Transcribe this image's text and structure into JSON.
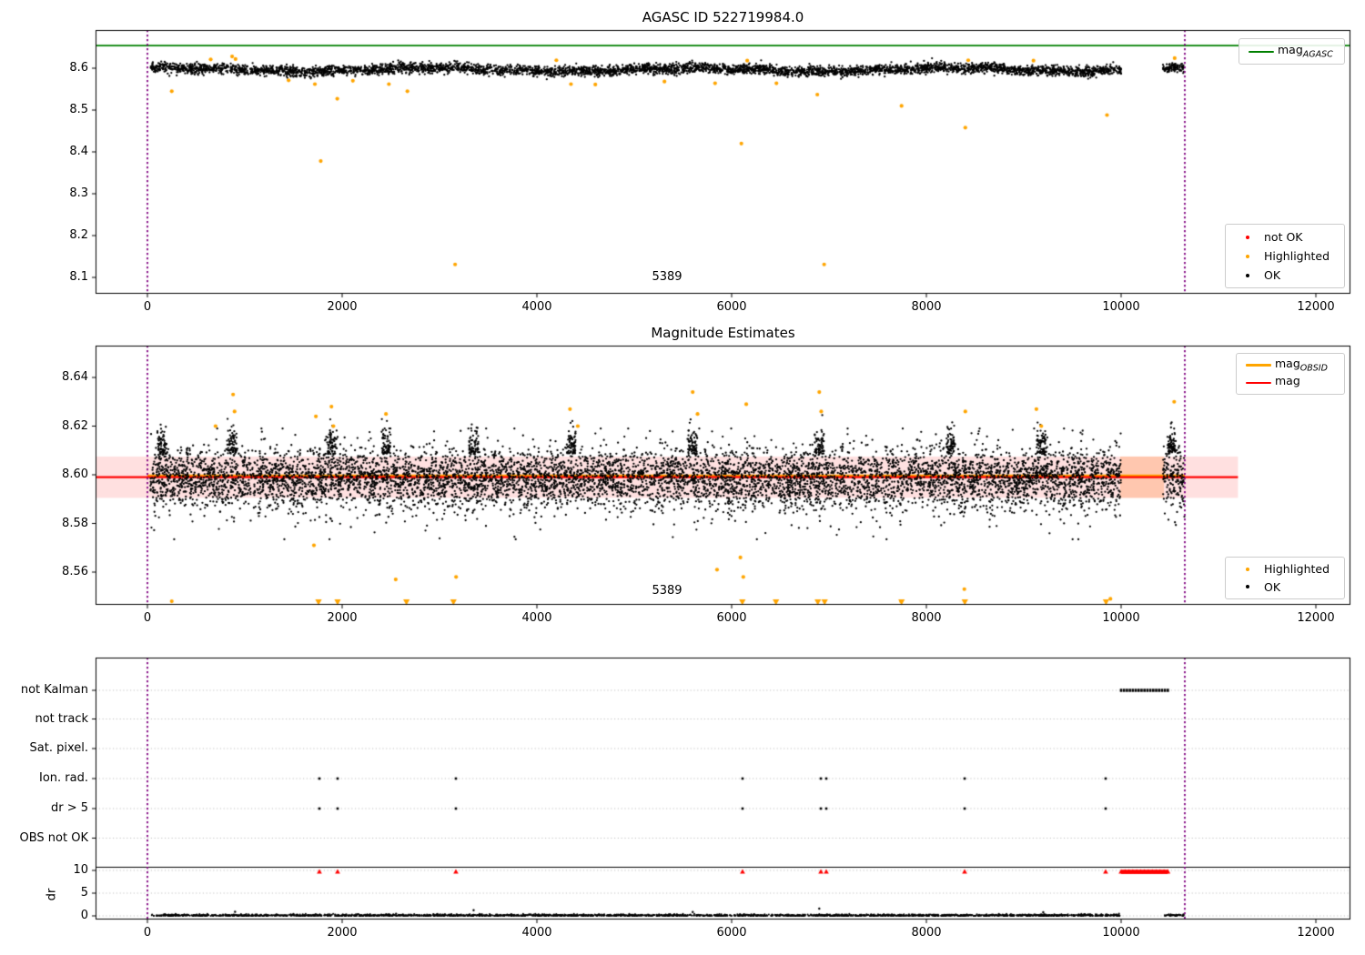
{
  "colors": {
    "ok": "#000000",
    "highlighted": "#ffa500",
    "not_ok": "#ff0000",
    "agasc_line": "#008000",
    "mag_line": "#ff0000",
    "obsid_line": "#ffa500",
    "obsid_boundary": "#800080",
    "band_fill": "rgba(255,0,0,0.12)",
    "flagged_fill": "rgba(255,140,60,0.30)",
    "gridline": "#c0c0c0"
  },
  "panels": {
    "top": {
      "title": "AGASC ID 522719984.0",
      "annotation": "5389",
      "legend_line": {
        "prefix": "mag",
        "sub": "AGASC",
        "color": "#008000"
      },
      "legend_markers": [
        {
          "label": "not OK",
          "color": "#ff0000"
        },
        {
          "label": "Highlighted",
          "color": "#ffa500"
        },
        {
          "label": "OK",
          "color": "#000000"
        }
      ]
    },
    "middle": {
      "title": "Magnitude Estimates",
      "annotation": "5389",
      "legend_lines": [
        {
          "prefix": "mag",
          "sub": "OBSID",
          "color": "#ffa500"
        },
        {
          "prefix": "mag",
          "sub": "",
          "color": "#ff0000"
        }
      ],
      "legend_markers": [
        {
          "label": "Highlighted",
          "color": "#ffa500"
        },
        {
          "label": "OK",
          "color": "#000000"
        }
      ]
    },
    "bottom": {
      "dr_label": "dr"
    }
  },
  "chart_data": [
    {
      "type": "scatter",
      "title": "AGASC ID 522719984.0",
      "xlim": [
        -533,
        12355
      ],
      "ylim": [
        8.061,
        8.691
      ],
      "xticks": [
        0,
        2000,
        4000,
        6000,
        8000,
        10000,
        12000
      ],
      "yticks": [
        {
          "v": 8.1,
          "label": "8.1"
        },
        {
          "v": 8.2,
          "label": "8.2"
        },
        {
          "v": 8.3,
          "label": "8.3"
        },
        {
          "v": 8.4,
          "label": "8.4"
        },
        {
          "v": 8.5,
          "label": "8.5"
        },
        {
          "v": 8.6,
          "label": "8.6"
        }
      ],
      "agasc_mag_line": {
        "value": 8.654,
        "color": "#008000"
      },
      "obsid_boundaries": [
        0,
        10654
      ],
      "annotation": {
        "text": "5389",
        "x": 5320,
        "y": 8.082
      },
      "ok_scatter": {
        "segments": [
          [
            30,
            10000
          ],
          [
            10430,
            10650
          ]
        ],
        "mean": 8.597,
        "sigma": 0.0062,
        "count": 4600,
        "range": [
          8.5735,
          8.6275
        ]
      },
      "highlighted_points": [
        [
          250,
          8.545
        ],
        [
          650,
          8.621
        ],
        [
          870,
          8.628
        ],
        [
          905,
          8.622
        ],
        [
          1450,
          8.571
        ],
        [
          1720,
          8.562
        ],
        [
          1780,
          8.378
        ],
        [
          1950,
          8.527
        ],
        [
          2110,
          8.57
        ],
        [
          2480,
          8.562
        ],
        [
          2670,
          8.545
        ],
        [
          3160,
          8.131
        ],
        [
          4200,
          8.619
        ],
        [
          4350,
          8.562
        ],
        [
          4600,
          8.561
        ],
        [
          5310,
          8.568
        ],
        [
          5830,
          8.564
        ],
        [
          6100,
          8.42
        ],
        [
          6160,
          8.618
        ],
        [
          6460,
          8.564
        ],
        [
          6880,
          8.537
        ],
        [
          6950,
          8.131
        ],
        [
          7745,
          8.51
        ],
        [
          8400,
          8.458
        ],
        [
          8430,
          8.619
        ],
        [
          9100,
          8.618
        ],
        [
          9855,
          8.488
        ],
        [
          10550,
          8.624
        ]
      ]
    },
    {
      "type": "scatter",
      "title": "Magnitude Estimates",
      "xlim": [
        -533,
        12355
      ],
      "ylim": [
        8.5465,
        8.6531
      ],
      "xticks": [
        0,
        2000,
        4000,
        6000,
        8000,
        10000,
        12000
      ],
      "yticks": [
        {
          "v": 8.56,
          "label": "8.56"
        },
        {
          "v": 8.58,
          "label": "8.58"
        },
        {
          "v": 8.6,
          "label": "8.60"
        },
        {
          "v": 8.62,
          "label": "8.62"
        },
        {
          "v": 8.64,
          "label": "8.64"
        }
      ],
      "mag_line": {
        "value": 8.599,
        "xspan": [
          -533,
          11200
        ],
        "color": "#ff0000"
      },
      "mag_err_band": {
        "lo": 8.5905,
        "hi": 8.6075,
        "xspan": [
          -533,
          11200
        ]
      },
      "obsid_mag_line": {
        "value": 8.5995,
        "xspan": [
          0,
          10654
        ],
        "color": "#ffa500"
      },
      "flagged_interval": {
        "xspan": [
          9990,
          10440
        ]
      },
      "obsid_boundaries": [
        0,
        10654
      ],
      "annotation": {
        "text": "5389",
        "x": 5320,
        "y": 8.5515
      },
      "ok_scatter": {
        "segments": [
          [
            30,
            10000
          ],
          [
            10430,
            10650
          ]
        ],
        "mean": 8.5985,
        "sigma": 0.0058,
        "count": 7600,
        "range": [
          8.5735,
          8.619
        ],
        "burst_centers": [
          150,
          870,
          1900,
          2450,
          3350,
          4350,
          5600,
          6900,
          8250,
          9180,
          10520
        ],
        "burst_top": 8.6245
      },
      "highlighted_points": [
        [
          250,
          8.548
        ],
        [
          700,
          8.62
        ],
        [
          880,
          8.633
        ],
        [
          895,
          8.626
        ],
        [
          1710,
          8.571
        ],
        [
          1730,
          8.624
        ],
        [
          1890,
          8.628
        ],
        [
          1910,
          8.62
        ],
        [
          2450,
          8.625
        ],
        [
          2550,
          8.557
        ],
        [
          3170,
          8.558
        ],
        [
          4340,
          8.627
        ],
        [
          4420,
          8.62
        ],
        [
          5600,
          8.634
        ],
        [
          5650,
          8.625
        ],
        [
          5850,
          8.561
        ],
        [
          6090,
          8.566
        ],
        [
          6120,
          8.558
        ],
        [
          6150,
          8.629
        ],
        [
          6900,
          8.634
        ],
        [
          6920,
          8.626
        ],
        [
          7740,
          8.548
        ],
        [
          8390,
          8.553
        ],
        [
          8400,
          8.626
        ],
        [
          9130,
          8.627
        ],
        [
          9180,
          8.62
        ],
        [
          9890,
          8.549
        ],
        [
          10545,
          8.63
        ]
      ],
      "highlighted_clipped_low_x": [
        1757,
        1953,
        2660,
        3143,
        6110,
        6455,
        6885,
        6955,
        7745,
        8395,
        9845
      ]
    },
    {
      "type": "flags",
      "rows": [
        "not Kalman",
        "not track",
        "Sat. pixel.",
        "Ion. rad.",
        "dr > 5",
        "OBS not OK"
      ],
      "xticks": [
        0,
        2000,
        4000,
        6000,
        8000,
        10000,
        12000
      ],
      "obsid_boundaries": [
        0,
        10654
      ],
      "not_kalman_interval": [
        10000,
        10480
      ],
      "ion_rad_x": [
        1766,
        1953,
        3168,
        6112,
        6916,
        6972,
        8393,
        9841
      ],
      "dr_gt5_x": [
        1766,
        1953,
        3168,
        6112,
        6916,
        6972,
        8393,
        9841
      ],
      "dr": {
        "label": "dr",
        "yticks": [
          0,
          5,
          10
        ],
        "separator_value": 10.7,
        "black_segments": [
          [
            30,
            9990
          ],
          [
            10440,
            10650
          ]
        ],
        "black_max": 0.55,
        "spikes": [
          [
            900,
            0.9
          ],
          [
            3350,
            1.25
          ],
          [
            5600,
            0.85
          ],
          [
            6900,
            1.6
          ],
          [
            9200,
            0.8
          ]
        ],
        "red_clipped_x": [
          1766,
          1953,
          3168,
          6112,
          6916,
          6972,
          8393,
          9841
        ],
        "red_clipped_interval": [
          10000,
          10480
        ],
        "red_clip_value": 9.75
      }
    }
  ]
}
